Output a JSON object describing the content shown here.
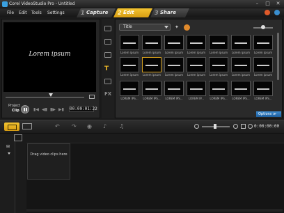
{
  "window": {
    "title": "Corel VideoStudio Pro - Untitled",
    "controls": [
      "–",
      "□",
      "✕"
    ]
  },
  "menu": [
    "File",
    "Edit",
    "Tools",
    "Settings"
  ],
  "steps": [
    {
      "num": "1",
      "label": "Capture",
      "active": false
    },
    {
      "num": "2",
      "label": "Edit",
      "active": true
    },
    {
      "num": "3",
      "label": "Share",
      "active": false
    }
  ],
  "preview": {
    "overlay_text": "Lorem ipsum",
    "project_label": "Project",
    "clip_label": "Clip",
    "timecode": "00:00:01:22"
  },
  "library": {
    "category": "Title",
    "options_label": "Options ≫",
    "thumbnails": [
      {
        "caption": "Lorem ipsum"
      },
      {
        "caption": "Lorem ipsum"
      },
      {
        "caption": "Lorem ipsum"
      },
      {
        "caption": "Lorem ipsum"
      },
      {
        "caption": "Lorem ipsum"
      },
      {
        "caption": "Lorem ipsum"
      },
      {
        "caption": "Lorem ipsum"
      },
      {
        "caption": "Lorem ipsum"
      },
      {
        "caption": "Lorem ipsum"
      },
      {
        "caption": "Lorem ipsum"
      },
      {
        "caption": "Lorem ipsum"
      },
      {
        "caption": "Lorem ipsum"
      },
      {
        "caption": "Lorem ipsum"
      },
      {
        "caption": "Lorem ipsum"
      },
      {
        "caption": "LOREM IPS..."
      },
      {
        "caption": "LOREM IPS..."
      },
      {
        "caption": "LOREM IPS..."
      },
      {
        "caption": "LOREM IP..."
      },
      {
        "caption": "LOREM IPS..."
      },
      {
        "caption": "LOREM IPS..."
      },
      {
        "caption": "LOREM IPS..."
      }
    ]
  },
  "timeline": {
    "timecode": "0:00:00:00",
    "drag_hint": "Drag video clips here"
  },
  "colors": {
    "accent": "#e0ae22",
    "options": "#2f76b8"
  }
}
